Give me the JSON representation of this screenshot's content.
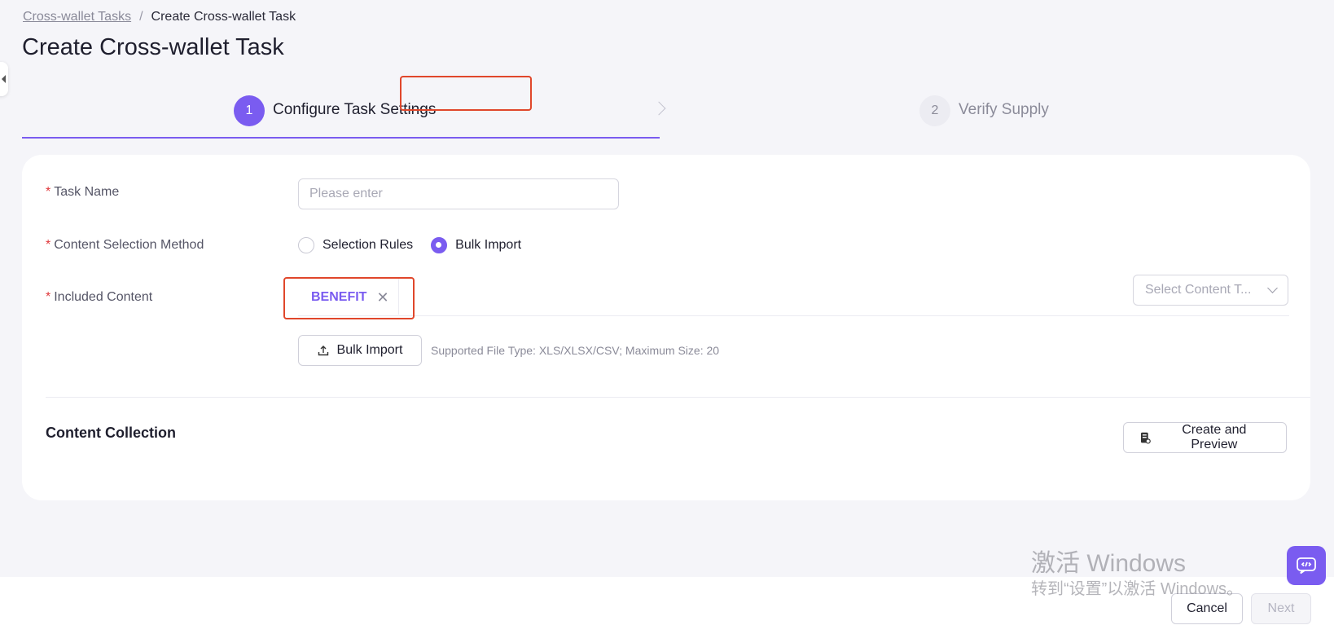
{
  "breadcrumb": {
    "parent": "Cross-wallet Tasks",
    "separator": "/",
    "current": "Create Cross-wallet Task"
  },
  "page": {
    "title": "Create Cross-wallet Task"
  },
  "steps": [
    {
      "number": "1",
      "label": "Configure Task Settings",
      "state": "active"
    },
    {
      "number": "2",
      "label": "Verify Supply",
      "state": "pending"
    }
  ],
  "form": {
    "task_name": {
      "label": "Task Name",
      "required_mark": "*",
      "placeholder": "Please enter",
      "value": ""
    },
    "selection_method": {
      "label": "Content Selection Method",
      "required_mark": "*",
      "options": [
        "Selection Rules",
        "Bulk Import"
      ],
      "selected": "Bulk Import"
    },
    "included_content": {
      "label": "Included Content",
      "required_mark": "*",
      "tags": [
        "BENEFIT"
      ],
      "select_placeholder": "Select Content T..."
    },
    "bulk_import_button": "Bulk Import",
    "hint": "Supported File Type: XLS/XLSX/CSV; Maximum Size: 20"
  },
  "content_collection": {
    "title": "Content Collection",
    "preview_button": "Create and Preview"
  },
  "footer": {
    "cancel": "Cancel",
    "next": "Next"
  },
  "watermark": {
    "line1": "激活 Windows",
    "line2": "转到“设置”以激活 Windows。"
  },
  "colors": {
    "accent": "#7a5cf0",
    "required": "#e0383b",
    "highlight_box": "#e0472b"
  },
  "icons": [
    "collapse-icon",
    "chevron-right-icon",
    "close-icon",
    "chevron-down-icon",
    "upload-icon",
    "document-icon",
    "support-chat-icon"
  ]
}
